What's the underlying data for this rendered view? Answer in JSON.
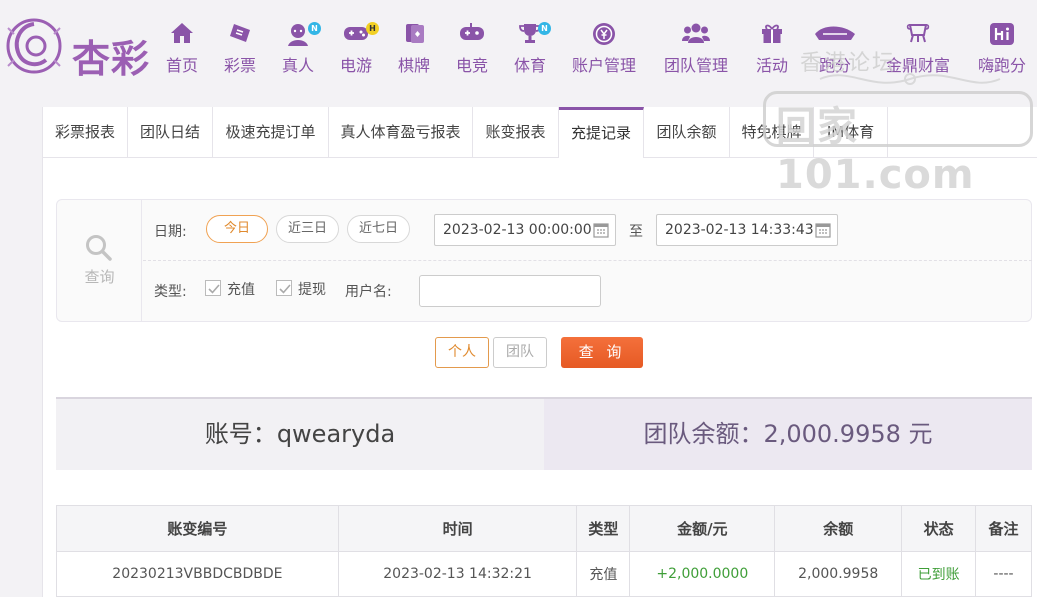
{
  "brand": {
    "name": "杏彩"
  },
  "nav": [
    {
      "label": "首页",
      "icon": "home-icon",
      "badge": ""
    },
    {
      "label": "彩票",
      "icon": "lottery-ticket-icon",
      "badge": ""
    },
    {
      "label": "真人",
      "icon": "live-dealer-icon",
      "badge": "N"
    },
    {
      "label": "电游",
      "icon": "gamepad-icon",
      "badge": "H"
    },
    {
      "label": "棋牌",
      "icon": "cards-icon",
      "badge": ""
    },
    {
      "label": "电竞",
      "icon": "esports-gamepad-icon",
      "badge": ""
    },
    {
      "label": "体育",
      "icon": "trophy-icon",
      "badge": "N"
    },
    {
      "label": "账户管理",
      "icon": "account-coin-icon",
      "badge": ""
    },
    {
      "label": "团队管理",
      "icon": "team-icon",
      "badge": ""
    },
    {
      "label": "活动",
      "icon": "gift-icon",
      "badge": ""
    },
    {
      "label": "跑分",
      "icon": "running-icon",
      "badge": ""
    },
    {
      "label": "金鼎财富",
      "icon": "wealth-icon",
      "badge": ""
    },
    {
      "label": "嗨跑分",
      "icon": "hi-icon",
      "badge": ""
    }
  ],
  "watermark": {
    "top": "香港论坛",
    "main": "回家101.com"
  },
  "tabs": [
    "彩票报表",
    "团队日结",
    "极速充提订单",
    "真人体育盈亏报表",
    "账变报表",
    "充提记录",
    "团队余额",
    "特免棋牌",
    "IM体育"
  ],
  "active_tab": "充提记录",
  "filter": {
    "search_label": "查询",
    "date_label": "日期:",
    "quick_dates": [
      "今日",
      "近三日",
      "近七日"
    ],
    "start_date": "2023-02-13 00:00:00",
    "to_label": "至",
    "end_date": "2023-02-13 14:33:43",
    "type_label": "类型:",
    "types": [
      {
        "label": "充值",
        "checked": true
      },
      {
        "label": "提现",
        "checked": true
      }
    ],
    "username_label": "用户名:",
    "username_value": ""
  },
  "actions": {
    "personal": "个人",
    "team": "团队",
    "query": "查 询"
  },
  "summary": {
    "account_label": "账号：",
    "account": "qwearyda",
    "team_balance_label": "团队余额：",
    "team_balance": "2,000.9958",
    "team_balance_unit": "元"
  },
  "table": {
    "headers": [
      "账变编号",
      "时间",
      "类型",
      "金额/元",
      "余额",
      "状态",
      "备注"
    ],
    "rows": [
      [
        "20230213VBBDCBDBDE",
        "2023-02-13 14:32:21",
        "充值",
        "+2,000.0000",
        "2,000.9958",
        "已到账",
        "----"
      ]
    ]
  },
  "colors": {
    "brand_purple": "#8a54a8",
    "accent_orange": "#e65a24",
    "success_green": "#3f9e38"
  }
}
